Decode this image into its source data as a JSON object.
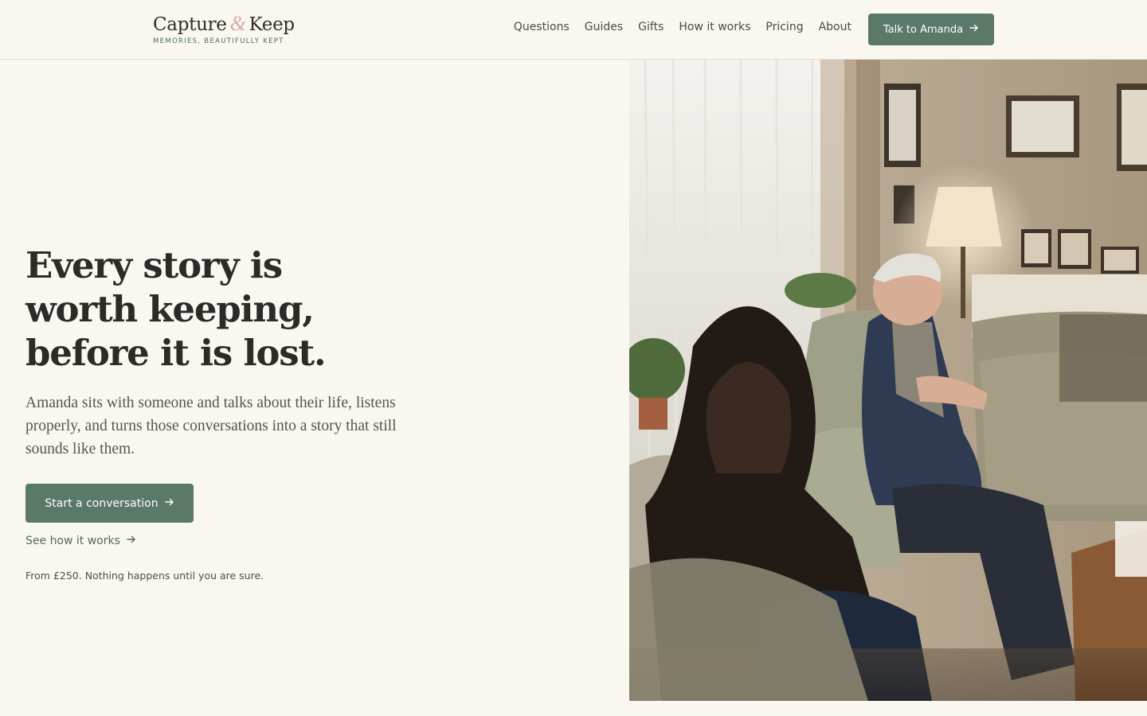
{
  "brand": {
    "name_part1": "Capture",
    "ampersand": "&",
    "name_part2": "Keep",
    "tagline": "MEMORIES, BEAUTIFULLY KEPT"
  },
  "nav": {
    "items": [
      {
        "label": "Questions"
      },
      {
        "label": "Guides"
      },
      {
        "label": "Gifts"
      },
      {
        "label": "How it works"
      },
      {
        "label": "Pricing"
      },
      {
        "label": "About"
      }
    ],
    "cta_label": "Talk to Amanda",
    "cta_icon": "arrow-right-icon"
  },
  "hero": {
    "title_line1": "Every story is",
    "title_line2": "worth keeping,",
    "title_line3": "before it is lost.",
    "subtitle": "Amanda sits with someone and talks about their life, listens properly, and turns those conversations into a story that still sounds like them.",
    "primary_cta": "Start a conversation",
    "secondary_cta": "See how it works",
    "note": "From £250. Nothing happens until you are sure."
  },
  "photo": {
    "subject": "elderly-man-talking-with-woman-in-living-room"
  },
  "colors": {
    "background": "#faf7f1",
    "accent": "#5a7968",
    "ampersand": "#d8a9a6",
    "text": "#2b2b28"
  }
}
